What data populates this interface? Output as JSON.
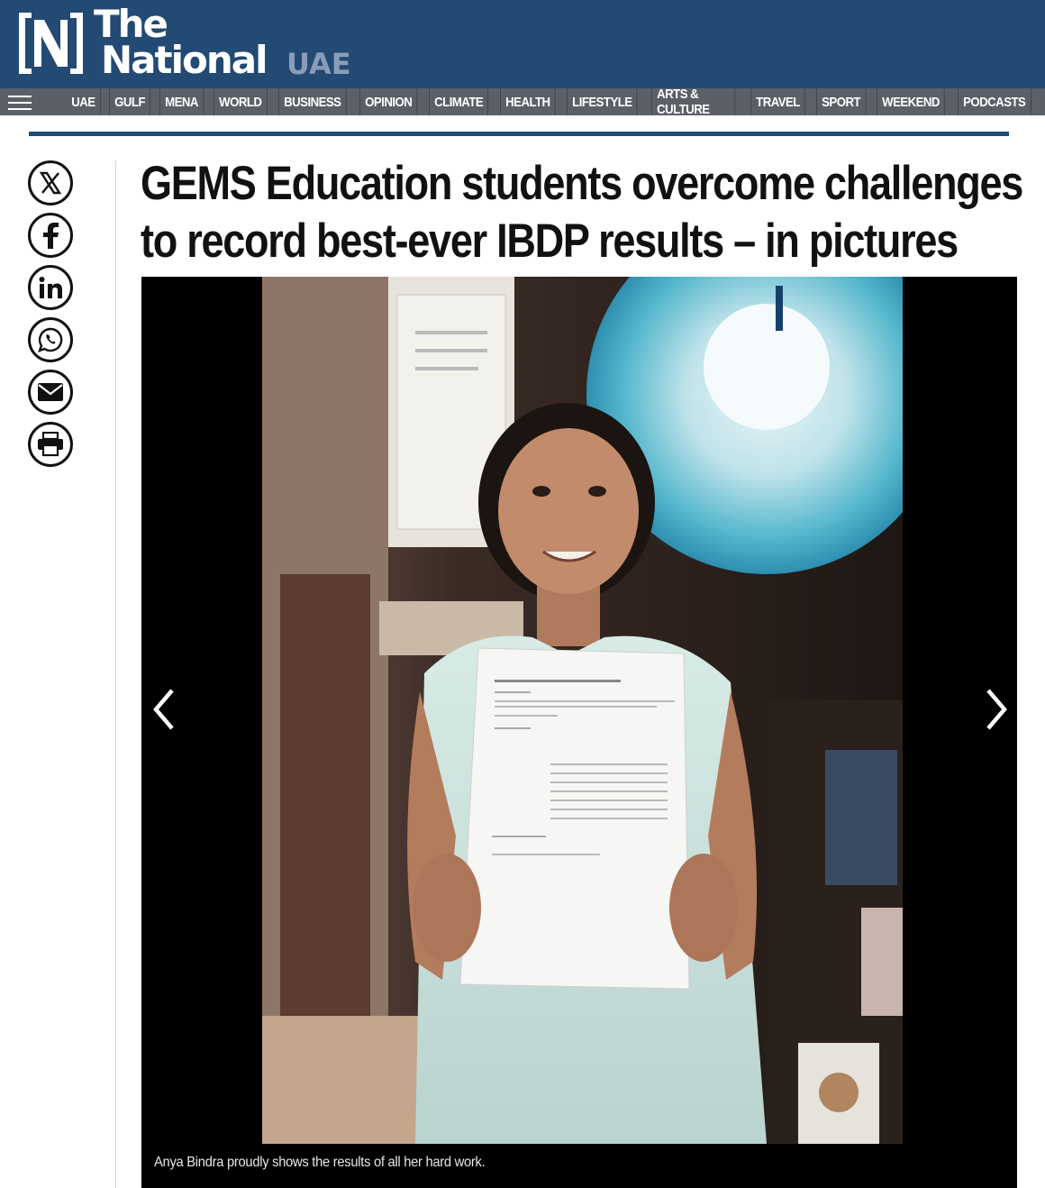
{
  "brand": {
    "line1": "The",
    "line2": "National",
    "region": "UAE",
    "colors": {
      "primary": "#234a73",
      "nav": "#5b6068",
      "region": "#8a9db8"
    }
  },
  "nav": {
    "menu_icon": "hamburger-menu-icon",
    "items": [
      "UAE",
      "GULF",
      "MENA",
      "WORLD",
      "BUSINESS",
      "OPINION",
      "CLIMATE",
      "HEALTH",
      "LIFESTYLE",
      "ARTS & CULTURE",
      "TRAVEL",
      "SPORT",
      "WEEKEND",
      "PODCASTS"
    ]
  },
  "share": {
    "icons": [
      "x-icon",
      "facebook-icon",
      "linkedin-icon",
      "whatsapp-icon",
      "email-icon",
      "print-icon"
    ]
  },
  "article": {
    "headline": "GEMS Education students overcome challenges to record best-ever IBDP results – in pictures"
  },
  "gallery": {
    "caption": "Anya Bindra proudly shows the results of all her hard work.",
    "prev_icon": "chevron-left-icon",
    "next_icon": "chevron-right-icon",
    "document_lines": {
      "heading": "International Baccalaureate Organisation"
    }
  }
}
